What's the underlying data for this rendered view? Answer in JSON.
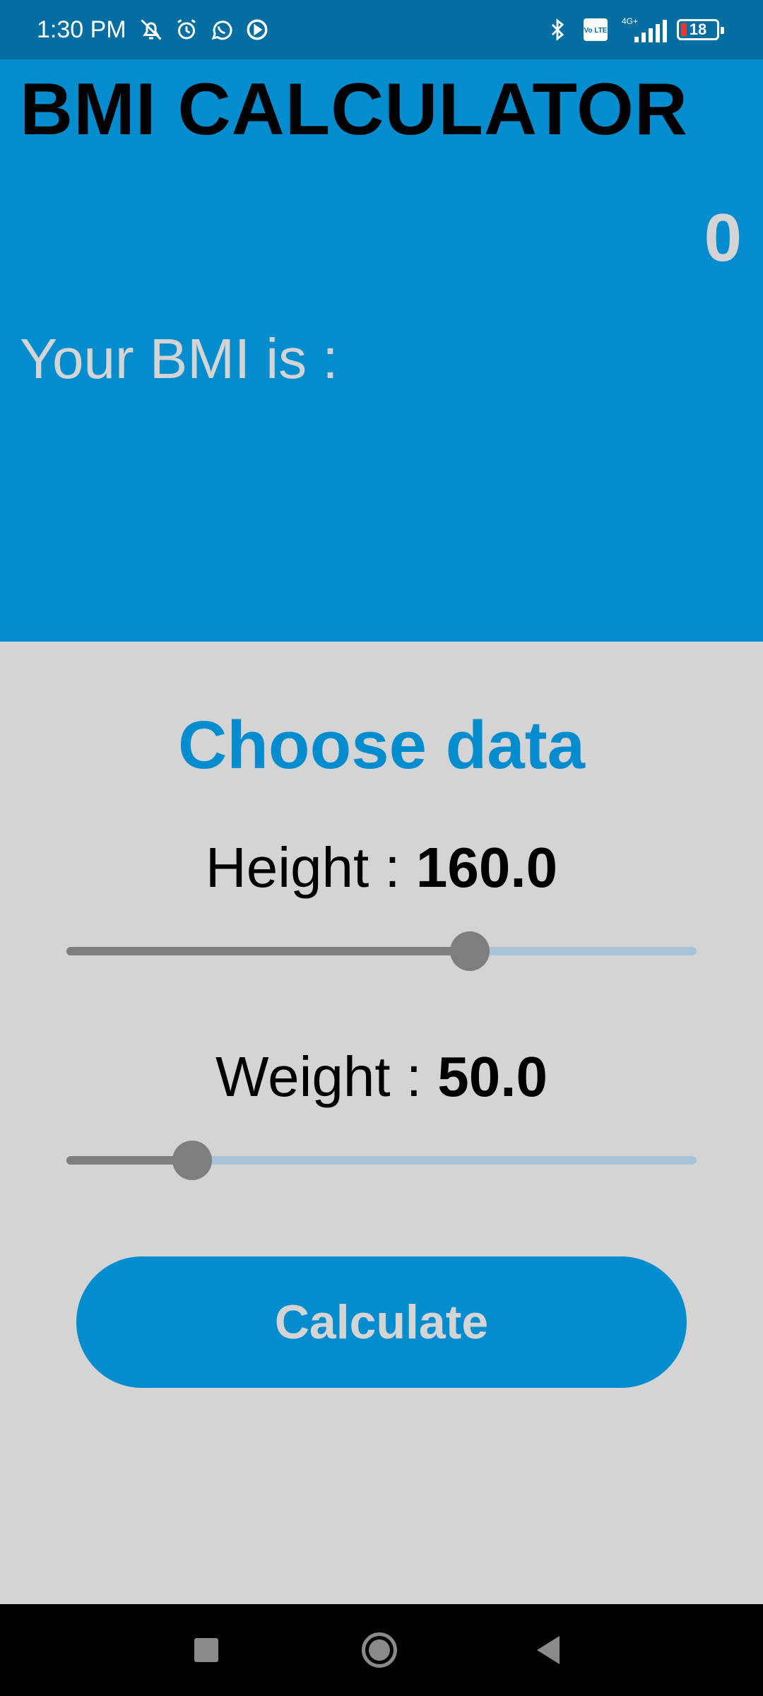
{
  "status_bar": {
    "time": "1:30 PM",
    "icons_left": [
      "mute-bell-icon",
      "alarm-icon",
      "whatsapp-icon",
      "media-play-icon"
    ],
    "icons_right": [
      "bluetooth-icon",
      "volte-icon",
      "4g-signal-icon"
    ],
    "network_label": "4G+",
    "volte_label": "Vo LTE",
    "battery_level": "18",
    "battery_color": "#e53935"
  },
  "header": {
    "title": "BMI CALCULATOR",
    "bmi_value": "0",
    "bmi_label": "Your BMI is :"
  },
  "form": {
    "section_title": "Choose data",
    "height": {
      "label": "Height : ",
      "value": "160.0",
      "fraction": 0.64
    },
    "weight": {
      "label": "Weight : ",
      "value": "50.0",
      "fraction": 0.2
    },
    "calculate_label": "Calculate"
  },
  "nav_bar": {
    "buttons": [
      "recent-apps-icon",
      "home-icon",
      "back-icon"
    ]
  },
  "colors": {
    "status_bar": "#046ea0",
    "primary": "#038dcf",
    "surface": "#d4d4d4",
    "slider_active": "#7e7e7e",
    "slider_inactive": "#a6c3d8"
  }
}
